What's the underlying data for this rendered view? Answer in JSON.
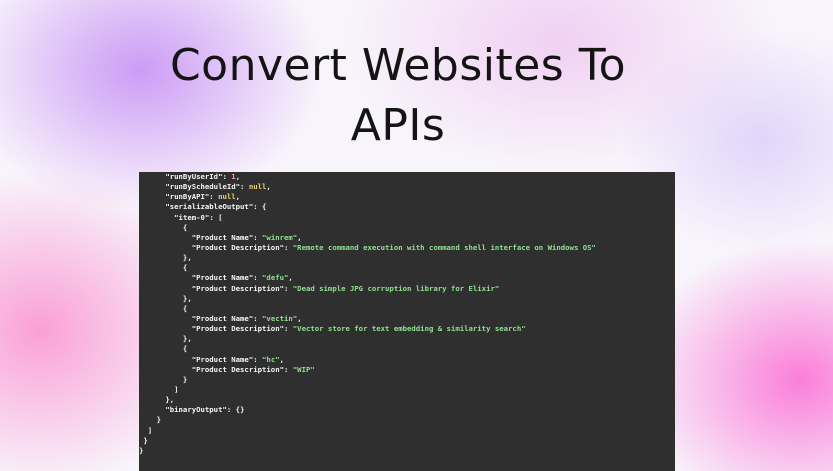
{
  "title": {
    "line1": "Convert Websites To",
    "line2": "APIs"
  },
  "code": {
    "run_by_user_id_key": "\"runByUserId\"",
    "run_by_user_id_value": "1",
    "run_by_schedule_id_key": "\"runByScheduleId\"",
    "run_by_schedule_id_value": "null",
    "run_by_api_key": "\"runByAPI\"",
    "run_by_api_value": "null",
    "serializable_output_key": "\"serializableOutput\"",
    "item_key": "\"item-0\"",
    "product_name_key": "\"Product Name\"",
    "product_description_key": "\"Product Description\"",
    "items": [
      {
        "name": "\"winrem\"",
        "description": "\"Remote command execution with command shell interface on Windows OS\""
      },
      {
        "name": "\"defu\"",
        "description": "\"Dead simple JPG corruption library for Elixir\""
      },
      {
        "name": "\"vectin\"",
        "description": "\"Vector store for text embedding & similarity search\""
      },
      {
        "name": "\"hc\"",
        "description": "\"WIP\""
      }
    ],
    "binary_output_key": "\"binaryOutput\"",
    "binary_output_value": "{}"
  }
}
